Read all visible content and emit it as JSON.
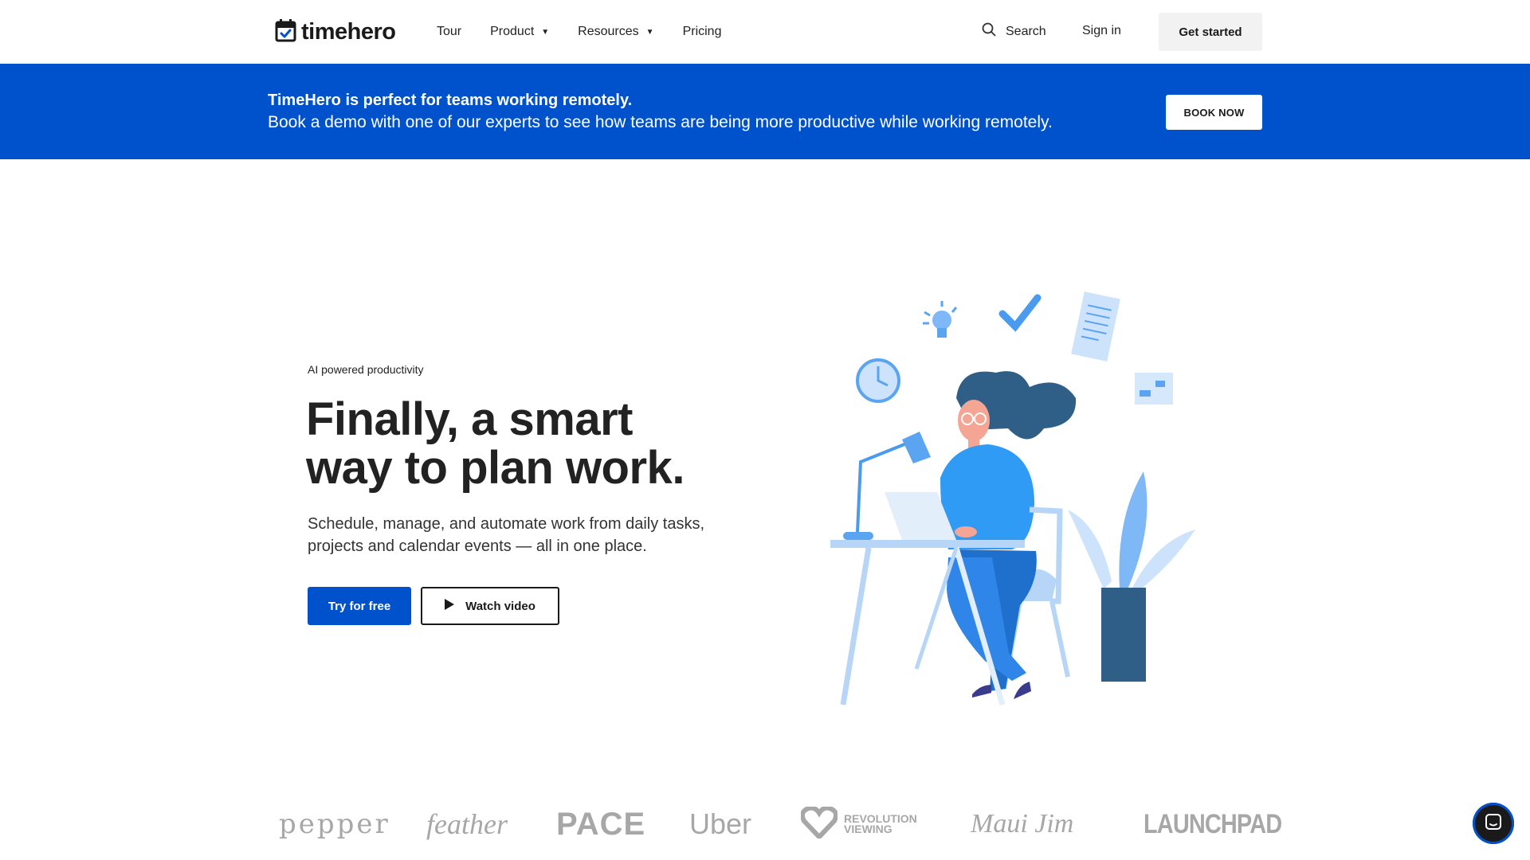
{
  "header": {
    "logo_text": "timehero",
    "nav": [
      {
        "label": "Tour",
        "has_dropdown": false
      },
      {
        "label": "Product",
        "has_dropdown": true
      },
      {
        "label": "Resources",
        "has_dropdown": true
      },
      {
        "label": "Pricing",
        "has_dropdown": false
      }
    ],
    "search_label": "Search",
    "signin_label": "Sign in",
    "cta_label": "Get started"
  },
  "banner": {
    "title": "TimeHero is perfect for teams working remotely.",
    "subtitle": "Book a demo with one of our experts to see how teams are being more productive while working remotely.",
    "button_label": "BOOK NOW"
  },
  "hero": {
    "eyebrow": "AI powered productivity",
    "headline_line1": "Finally, a smart",
    "headline_line2": "way to plan work.",
    "subtext": "Schedule, manage, and automate work from daily tasks, projects and calendar events — all in one place.",
    "primary_button": "Try for free",
    "secondary_button": "Watch video"
  },
  "customer_logos": {
    "pepper": "pepper",
    "feather": "feather",
    "pace": "PACE",
    "uber": "Uber",
    "revolution_line1": "REVOLUTION",
    "revolution_line2": "VIEWING",
    "maui": "Maui Jim",
    "launchpad": "LAUNCHPAD"
  },
  "colors": {
    "brand_blue": "#0052cc",
    "illustration_blue": "#2f9bf5",
    "illustration_dark": "#2f5f86",
    "logo_gray": "#a7a7a7"
  },
  "icons": {
    "logo": "calendar-check-icon",
    "search": "search-icon",
    "play": "play-icon",
    "chat": "chat-icon"
  }
}
